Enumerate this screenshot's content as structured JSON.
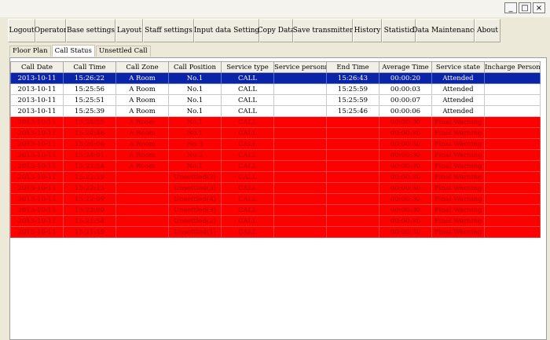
{
  "window": {
    "minimize_label": "_",
    "maximize_label": "□",
    "close_label": "×"
  },
  "menu": [
    "Logout",
    "Operator",
    "Base settings",
    "Layout",
    "Staff settings",
    "Input data Setting",
    "Copy Data",
    "Save transmitter",
    "History",
    "Statistic",
    "Data Maintenance",
    "About"
  ],
  "tabs": [
    "Floor Plan",
    "Call Status",
    "Unsettled Call"
  ],
  "active_tab": "Call Status",
  "table": {
    "columns": [
      "Call Date",
      "Call Time",
      "Call Zone",
      "Call Position",
      "Service type",
      "Service personnel",
      "End Time",
      "Average Time",
      "Service state",
      "Incharge Person"
    ],
    "rows": [
      {
        "state": "selected",
        "cells": [
          "2013-10-11",
          "15:26:22",
          "A Room",
          "No.1",
          "CALL",
          "",
          "15:26:43",
          "00:00:20",
          "Attended",
          ""
        ]
      },
      {
        "state": "normal",
        "cells": [
          "2013-10-11",
          "15:25:56",
          "A Room",
          "No.1",
          "CALL",
          "",
          "15:25:59",
          "00:00:03",
          "Attended",
          ""
        ]
      },
      {
        "state": "normal",
        "cells": [
          "2013-10-11",
          "15:25:51",
          "A Room",
          "No.1",
          "CALL",
          "",
          "15:25:59",
          "00:00:07",
          "Attended",
          ""
        ]
      },
      {
        "state": "normal",
        "cells": [
          "2013-10-11",
          "15:25:39",
          "A Room",
          "No.1",
          "CALL",
          "",
          "15:25:46",
          "00:00:06",
          "Attended",
          ""
        ]
      },
      {
        "state": "warning",
        "cells": [
          "2013-10-11",
          "15:24:55",
          "A Room",
          "No.1",
          "CALL",
          "",
          "",
          "00:00:30",
          "Final Warning",
          ""
        ]
      },
      {
        "state": "warning",
        "cells": [
          "2013-10-11",
          "15:24:46",
          "A Room",
          "No.1",
          "CALL",
          "",
          "",
          "00:00:30",
          "Final Warning",
          ""
        ]
      },
      {
        "state": "warning",
        "cells": [
          "2013-10-11",
          "15:24:06",
          "A Room",
          "No.3",
          "CALL",
          "",
          "",
          "00:00:30",
          "Final Warning",
          ""
        ]
      },
      {
        "state": "warning",
        "cells": [
          "2013-10-11",
          "15:24:01",
          "A Room",
          "No.2",
          "CALL",
          "",
          "",
          "00:00:30",
          "Final Warning",
          ""
        ]
      },
      {
        "state": "warning",
        "cells": [
          "2013-10-11",
          "15:23:54",
          "A Room",
          "No.1",
          "CALL",
          "",
          "",
          "00:00:30",
          "Final Warning",
          ""
        ]
      },
      {
        "state": "warning",
        "cells": [
          "2013-10-11",
          "15:22:19",
          "",
          "Unsettled(2)",
          "CALL",
          "",
          "",
          "00:00:30",
          "Final Warning",
          ""
        ]
      },
      {
        "state": "warning",
        "cells": [
          "2013-10-11",
          "15:22:13",
          "",
          "Unsettled(3)",
          "CALL",
          "",
          "",
          "00:00:30",
          "Final Warning",
          ""
        ]
      },
      {
        "state": "warning",
        "cells": [
          "2013-10-11",
          "15:22:09",
          "",
          "Unsettled(4)",
          "CALL",
          "",
          "",
          "00:00:30",
          "Final Warning",
          ""
        ]
      },
      {
        "state": "warning",
        "cells": [
          "2013-10-11",
          "15:22:00",
          "",
          "Unsettled(3)",
          "CALL",
          "",
          "",
          "00:00:30",
          "Final Warning",
          ""
        ]
      },
      {
        "state": "warning",
        "cells": [
          "2013-10-11",
          "15:21:54",
          "",
          "Unsettled(2)",
          "CALL",
          "",
          "",
          "00:00:30",
          "Final Warning",
          ""
        ]
      },
      {
        "state": "warning",
        "cells": [
          "2013-10-11",
          "15:21:49",
          "",
          "Unsettled(1)",
          "CALL",
          "",
          "",
          "00:00:30",
          "Final Warning",
          ""
        ]
      }
    ]
  },
  "colors": {
    "selected_row": "#0a24a8",
    "warning_row": "#ff0000",
    "warning_text": "#a80000"
  }
}
